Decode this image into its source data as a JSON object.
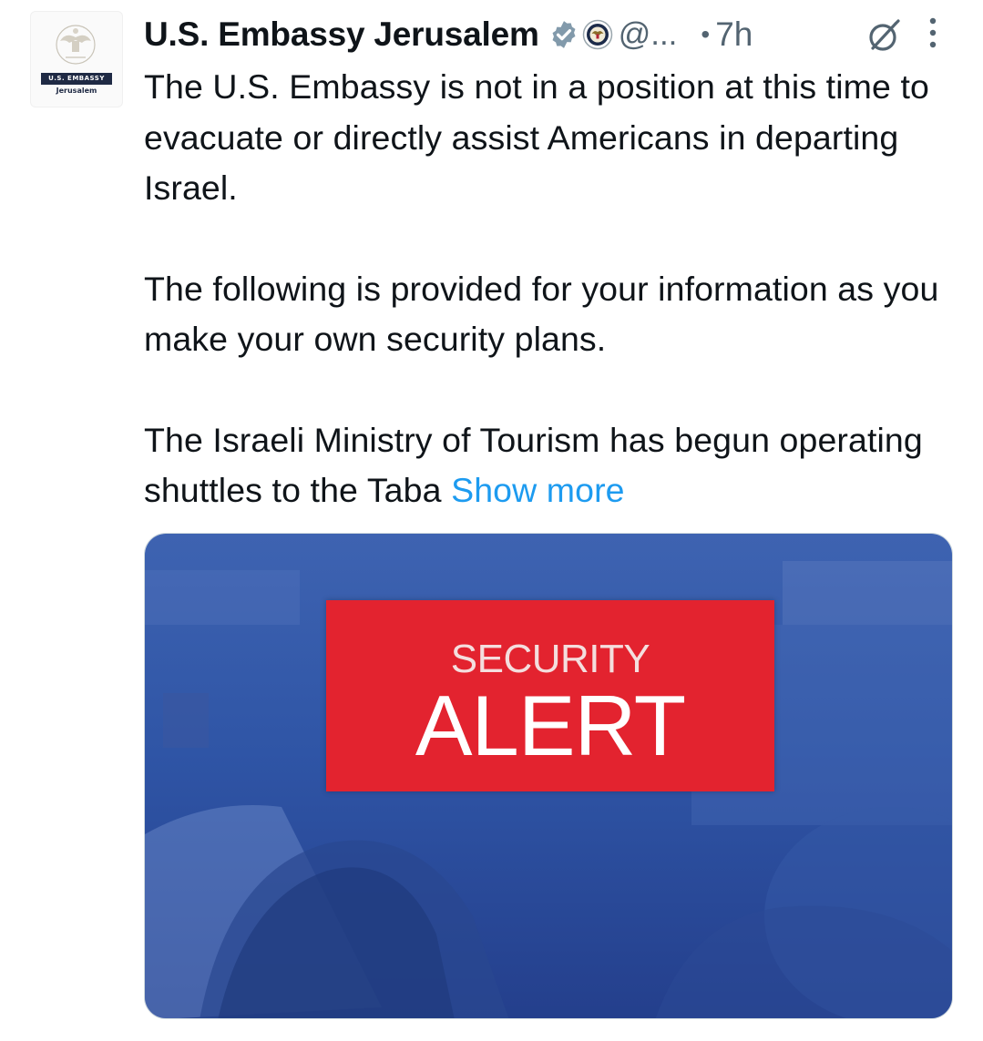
{
  "account": {
    "display_name": "U.S. Embassy Jerusalem",
    "handle": "@...",
    "separator": "•",
    "time": "7h",
    "avatar": {
      "banner": "U.S. EMBASSY",
      "subtitle": "Jerusalem"
    }
  },
  "tweet": {
    "paragraphs": [
      "The U.S. Embassy is not in a position at this time to evacuate or directly assist Americans in departing Israel.",
      "The following is provided for your information as you make your own security plans.",
      "The Israeli Ministry of Tourism has begun operating shuttles to the Taba"
    ],
    "show_more": "Show more"
  },
  "media": {
    "line1": "SECURITY",
    "line2": "ALERT"
  },
  "colors": {
    "link": "#1d9bf0",
    "verified": "#829aab",
    "alert_red": "#e3232f",
    "media_blue": "#2c4f9c"
  },
  "icons": [
    "verified-badge-icon",
    "affiliate-seal-icon",
    "grok-icon",
    "more-options-icon"
  ]
}
